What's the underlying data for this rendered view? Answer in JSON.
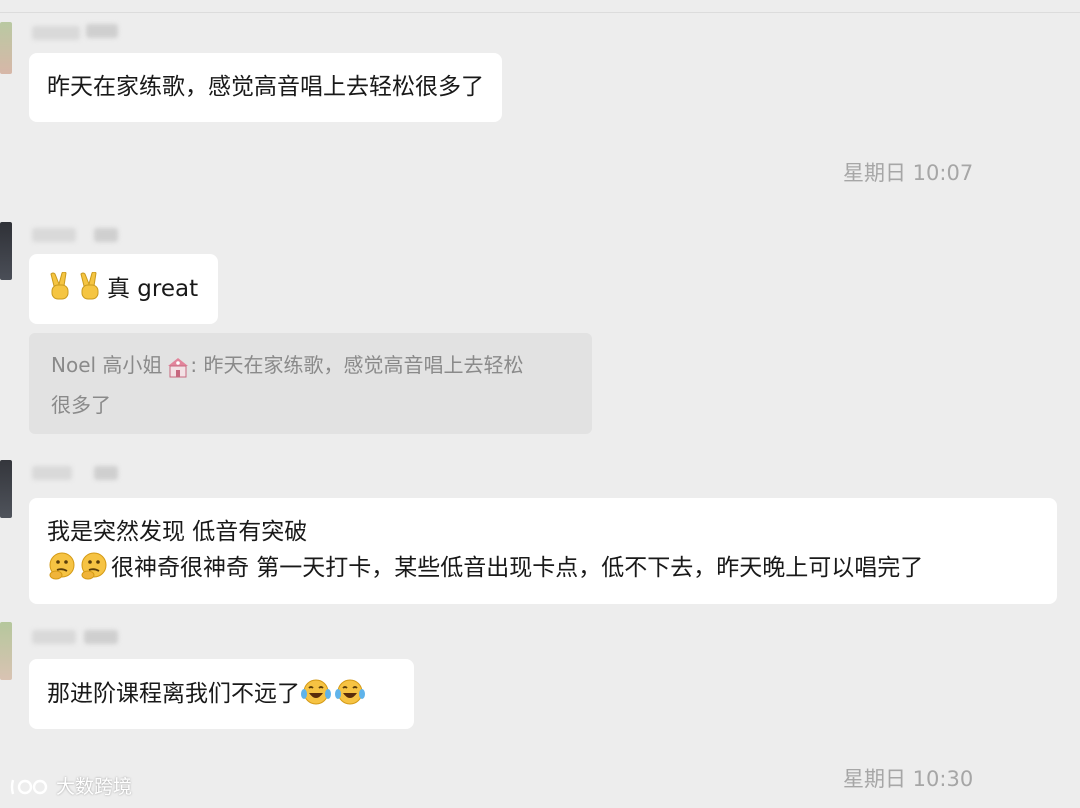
{
  "messages": [
    {
      "text": "昨天在家练歌，感觉高音唱上去轻松很多了"
    },
    {
      "text": "真 great"
    },
    {
      "line1": "我是突然发现  低音有突破",
      "line2": "很神奇很神奇   第一天打卡，某些低音出现卡点，低不下去，昨天晚上可以唱完了"
    },
    {
      "text": "那进阶课程离我们不远了"
    }
  ],
  "quote": {
    "author": "Noel 高小姐",
    "sep": ": ",
    "line1": "昨天在家练歌，感觉高音唱上去轻松",
    "line2": "很多了"
  },
  "times": [
    "星期日 10:07",
    "星期日 10:30"
  ],
  "watermark": "大数跨境",
  "icons": [
    "victory-hand-emoji",
    "thinking-face-emoji",
    "tears-of-joy-emoji",
    "school-building-emoji"
  ]
}
